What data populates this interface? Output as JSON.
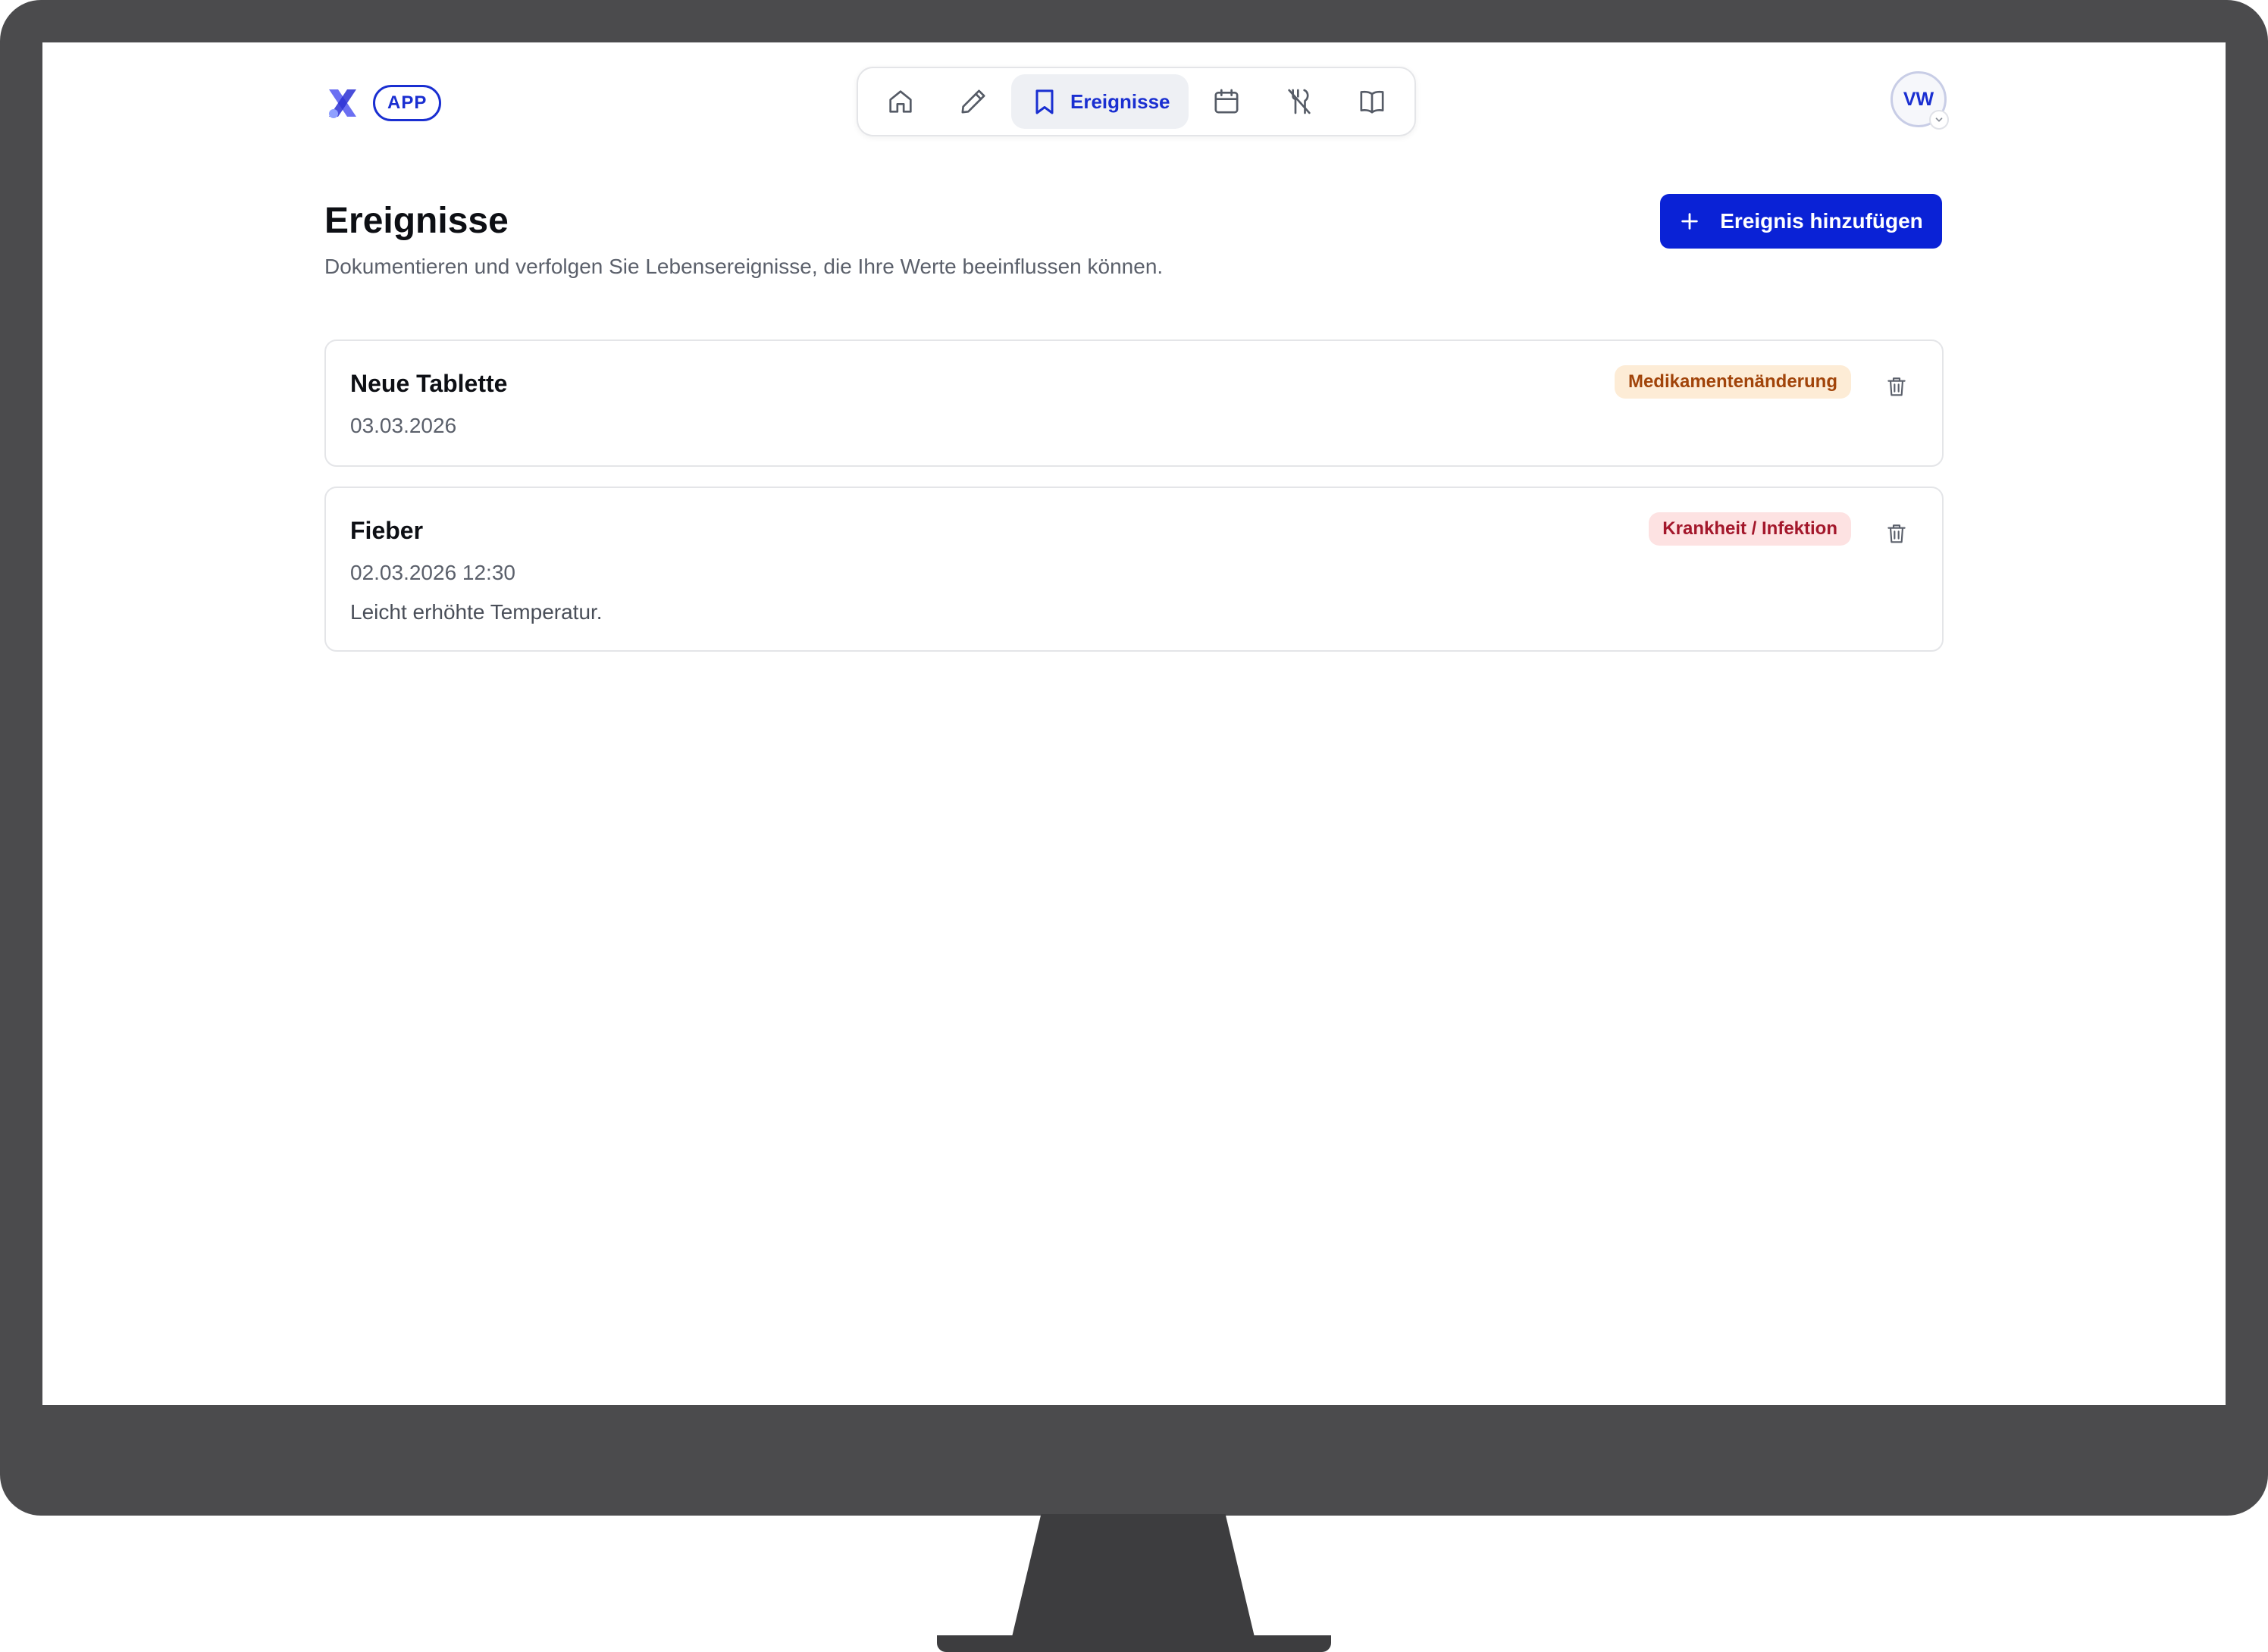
{
  "header": {
    "app_badge": "APP",
    "brand_color": "#1a2fd1",
    "nav": [
      {
        "icon": "home-icon"
      },
      {
        "icon": "pencil-icon"
      },
      {
        "icon": "bookmark-icon",
        "label": "Ereignisse",
        "active": true
      },
      {
        "icon": "calendar-icon"
      },
      {
        "icon": "utensils-off-icon"
      },
      {
        "icon": "book-open-icon"
      }
    ],
    "avatar_initials": "VW"
  },
  "page": {
    "title": "Ereignisse",
    "subtitle": "Dokumentieren und verfolgen Sie Lebensereignisse, die Ihre Werte beeinflussen können.",
    "add_button_label": "Ereignis hinzufügen"
  },
  "events": [
    {
      "title": "Neue Tablette",
      "date": "03.03.2026",
      "tag": "Medikamentenänderung",
      "tag_color": "#a1440a",
      "tag_bg": "#fdecd6"
    },
    {
      "title": "Fieber",
      "date": "02.03.2026 12:30",
      "note": "Leicht erhöhte Temperatur.",
      "tag": "Krankheit / Infektion",
      "tag_color": "#a3172b",
      "tag_bg": "#fde2e2"
    }
  ]
}
